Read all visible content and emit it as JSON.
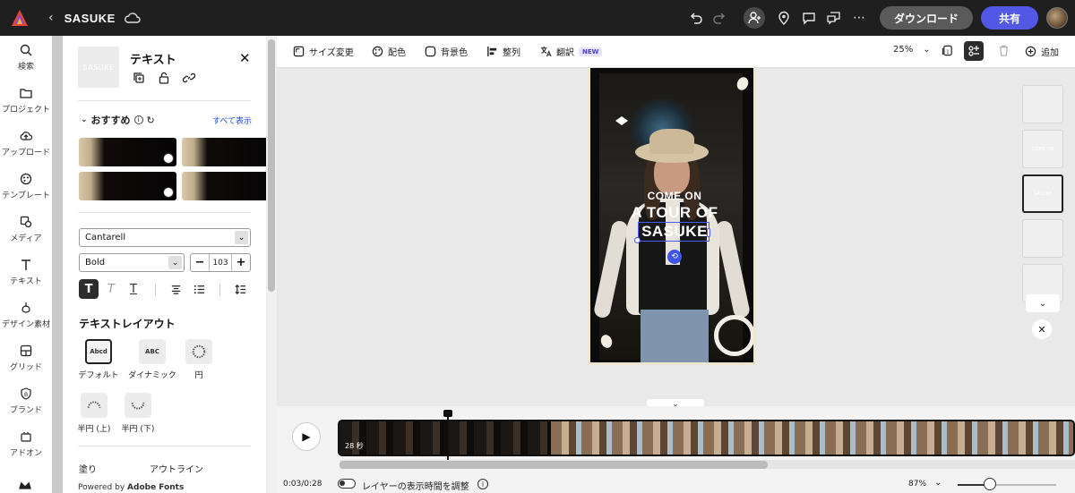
{
  "app": {
    "project_title": "SASUKE",
    "download_label": "ダウンロード",
    "share_label": "共有"
  },
  "rail": {
    "items": [
      {
        "label": "検索",
        "icon": "search-icon"
      },
      {
        "label": "プロジェクト",
        "icon": "folder-icon"
      },
      {
        "label": "アップロード",
        "icon": "upload-cloud-icon"
      },
      {
        "label": "テンプレート",
        "icon": "template-icon"
      },
      {
        "label": "メディア",
        "icon": "media-icon"
      },
      {
        "label": "テキスト",
        "icon": "text-icon"
      },
      {
        "label": "デザイン素材",
        "icon": "shapes-icon"
      },
      {
        "label": "グリッド",
        "icon": "grid-icon"
      },
      {
        "label": "ブランド",
        "icon": "brand-icon"
      },
      {
        "label": "アドオン",
        "icon": "addon-icon"
      }
    ]
  },
  "panel": {
    "element_thumb_text": "SASUKE",
    "title": "テキスト",
    "recommend_label": "おすすめ",
    "show_all": "すべて表示",
    "font_family": "Cantarell",
    "font_weight": "Bold",
    "font_size": "103",
    "layout_section_title": "テキストレイアウト",
    "layouts": [
      {
        "label": "デフォルト",
        "preview": "Abcd",
        "selected": true
      },
      {
        "label": "ダイナミック",
        "preview": "ABC",
        "selected": false
      },
      {
        "label": "円",
        "preview": "",
        "selected": false
      },
      {
        "label": "半円 (上)",
        "preview": "",
        "selected": false
      },
      {
        "label": "半円 (下)",
        "preview": "",
        "selected": false
      }
    ],
    "fill_label": "塗り",
    "outline_label": "アウトライン",
    "powered_prefix": "Powered by ",
    "powered_brand": "Adobe Fonts"
  },
  "canvas_toolbar": {
    "resize": "サイズ変更",
    "colors": "配色",
    "background": "背景色",
    "align": "整列",
    "translate": "翻訳",
    "new_badge": "NEW",
    "zoom": "25%",
    "add": "追加"
  },
  "canvas": {
    "line1": "COME ON",
    "line2": "A TOUR OF",
    "line3": "SASUKE"
  },
  "pages": {
    "thumbs": [
      "",
      "COME ON",
      "SASUKE",
      "",
      ""
    ],
    "selected_index": 2
  },
  "timeline": {
    "strip_label": "28 秒",
    "time": "0:03/0:28",
    "toggle_label": "レイヤーの表示時間を調整",
    "zoom": "87%"
  },
  "colors": {
    "accent": "#5258e4",
    "selection": "#4a5cff",
    "topbar": "#1f1f1f"
  }
}
